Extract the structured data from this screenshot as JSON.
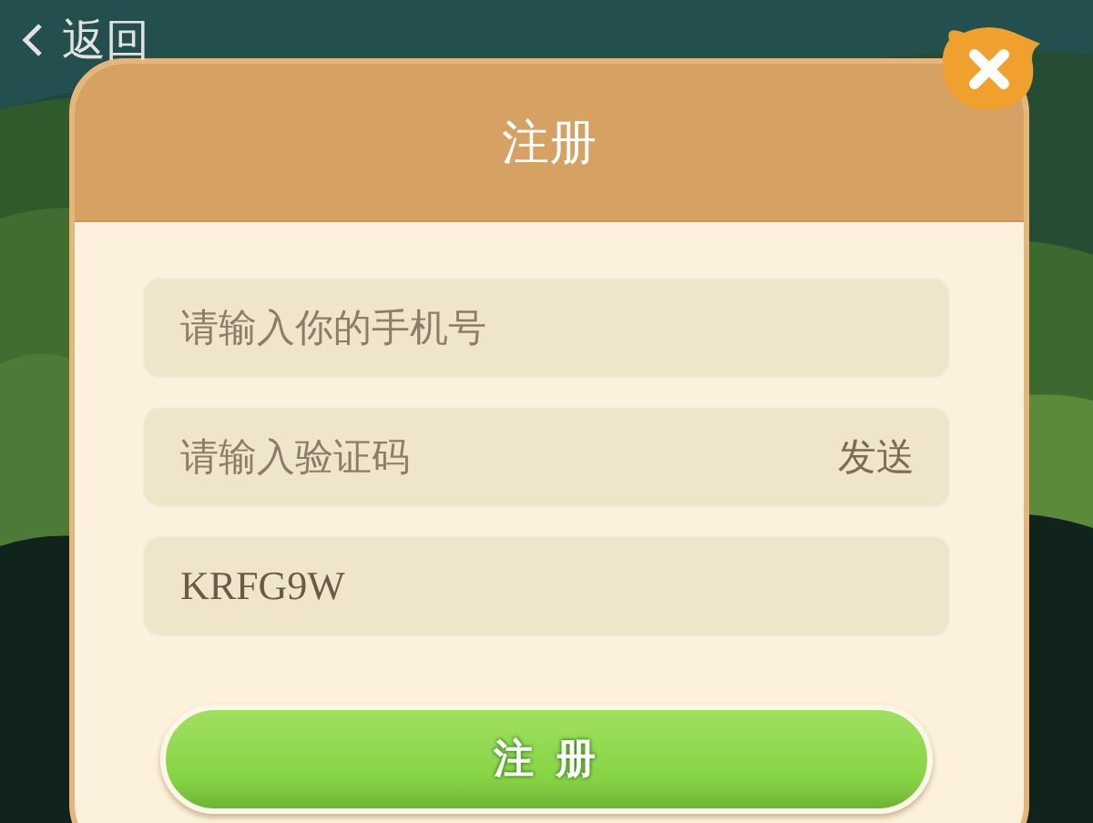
{
  "back_link": {
    "label": "返回"
  },
  "dialog": {
    "title": "注册",
    "fields": [
      {
        "placeholder": "请输入你的手机号"
      },
      {
        "placeholder": "请输入验证码",
        "action": "发送"
      },
      {
        "value": "KRFG9W"
      }
    ],
    "submit": "注 册"
  }
}
